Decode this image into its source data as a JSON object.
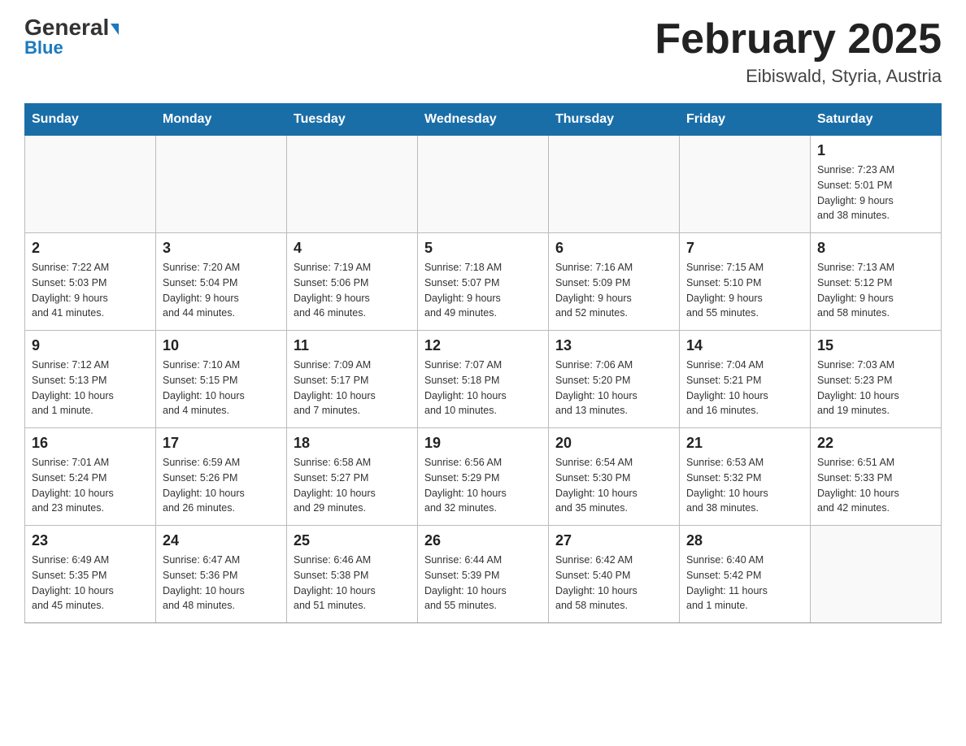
{
  "logo": {
    "general": "General",
    "blue": "Blue"
  },
  "header": {
    "title": "February 2025",
    "subtitle": "Eibiswald, Styria, Austria"
  },
  "weekdays": [
    "Sunday",
    "Monday",
    "Tuesday",
    "Wednesday",
    "Thursday",
    "Friday",
    "Saturday"
  ],
  "weeks": [
    [
      {
        "day": "",
        "info": ""
      },
      {
        "day": "",
        "info": ""
      },
      {
        "day": "",
        "info": ""
      },
      {
        "day": "",
        "info": ""
      },
      {
        "day": "",
        "info": ""
      },
      {
        "day": "",
        "info": ""
      },
      {
        "day": "1",
        "info": "Sunrise: 7:23 AM\nSunset: 5:01 PM\nDaylight: 9 hours\nand 38 minutes."
      }
    ],
    [
      {
        "day": "2",
        "info": "Sunrise: 7:22 AM\nSunset: 5:03 PM\nDaylight: 9 hours\nand 41 minutes."
      },
      {
        "day": "3",
        "info": "Sunrise: 7:20 AM\nSunset: 5:04 PM\nDaylight: 9 hours\nand 44 minutes."
      },
      {
        "day": "4",
        "info": "Sunrise: 7:19 AM\nSunset: 5:06 PM\nDaylight: 9 hours\nand 46 minutes."
      },
      {
        "day": "5",
        "info": "Sunrise: 7:18 AM\nSunset: 5:07 PM\nDaylight: 9 hours\nand 49 minutes."
      },
      {
        "day": "6",
        "info": "Sunrise: 7:16 AM\nSunset: 5:09 PM\nDaylight: 9 hours\nand 52 minutes."
      },
      {
        "day": "7",
        "info": "Sunrise: 7:15 AM\nSunset: 5:10 PM\nDaylight: 9 hours\nand 55 minutes."
      },
      {
        "day": "8",
        "info": "Sunrise: 7:13 AM\nSunset: 5:12 PM\nDaylight: 9 hours\nand 58 minutes."
      }
    ],
    [
      {
        "day": "9",
        "info": "Sunrise: 7:12 AM\nSunset: 5:13 PM\nDaylight: 10 hours\nand 1 minute."
      },
      {
        "day": "10",
        "info": "Sunrise: 7:10 AM\nSunset: 5:15 PM\nDaylight: 10 hours\nand 4 minutes."
      },
      {
        "day": "11",
        "info": "Sunrise: 7:09 AM\nSunset: 5:17 PM\nDaylight: 10 hours\nand 7 minutes."
      },
      {
        "day": "12",
        "info": "Sunrise: 7:07 AM\nSunset: 5:18 PM\nDaylight: 10 hours\nand 10 minutes."
      },
      {
        "day": "13",
        "info": "Sunrise: 7:06 AM\nSunset: 5:20 PM\nDaylight: 10 hours\nand 13 minutes."
      },
      {
        "day": "14",
        "info": "Sunrise: 7:04 AM\nSunset: 5:21 PM\nDaylight: 10 hours\nand 16 minutes."
      },
      {
        "day": "15",
        "info": "Sunrise: 7:03 AM\nSunset: 5:23 PM\nDaylight: 10 hours\nand 19 minutes."
      }
    ],
    [
      {
        "day": "16",
        "info": "Sunrise: 7:01 AM\nSunset: 5:24 PM\nDaylight: 10 hours\nand 23 minutes."
      },
      {
        "day": "17",
        "info": "Sunrise: 6:59 AM\nSunset: 5:26 PM\nDaylight: 10 hours\nand 26 minutes."
      },
      {
        "day": "18",
        "info": "Sunrise: 6:58 AM\nSunset: 5:27 PM\nDaylight: 10 hours\nand 29 minutes."
      },
      {
        "day": "19",
        "info": "Sunrise: 6:56 AM\nSunset: 5:29 PM\nDaylight: 10 hours\nand 32 minutes."
      },
      {
        "day": "20",
        "info": "Sunrise: 6:54 AM\nSunset: 5:30 PM\nDaylight: 10 hours\nand 35 minutes."
      },
      {
        "day": "21",
        "info": "Sunrise: 6:53 AM\nSunset: 5:32 PM\nDaylight: 10 hours\nand 38 minutes."
      },
      {
        "day": "22",
        "info": "Sunrise: 6:51 AM\nSunset: 5:33 PM\nDaylight: 10 hours\nand 42 minutes."
      }
    ],
    [
      {
        "day": "23",
        "info": "Sunrise: 6:49 AM\nSunset: 5:35 PM\nDaylight: 10 hours\nand 45 minutes."
      },
      {
        "day": "24",
        "info": "Sunrise: 6:47 AM\nSunset: 5:36 PM\nDaylight: 10 hours\nand 48 minutes."
      },
      {
        "day": "25",
        "info": "Sunrise: 6:46 AM\nSunset: 5:38 PM\nDaylight: 10 hours\nand 51 minutes."
      },
      {
        "day": "26",
        "info": "Sunrise: 6:44 AM\nSunset: 5:39 PM\nDaylight: 10 hours\nand 55 minutes."
      },
      {
        "day": "27",
        "info": "Sunrise: 6:42 AM\nSunset: 5:40 PM\nDaylight: 10 hours\nand 58 minutes."
      },
      {
        "day": "28",
        "info": "Sunrise: 6:40 AM\nSunset: 5:42 PM\nDaylight: 11 hours\nand 1 minute."
      },
      {
        "day": "",
        "info": ""
      }
    ]
  ]
}
